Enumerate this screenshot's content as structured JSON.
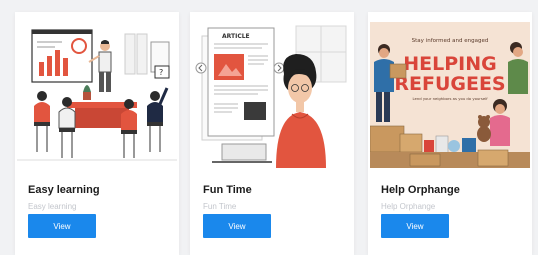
{
  "cards": [
    {
      "title": "Easy learning",
      "subtitle": "Easy learning",
      "button_label": "View",
      "image": "classroom-presentation-illustration"
    },
    {
      "title": "Fun Time",
      "subtitle": "Fun Time",
      "button_label": "View",
      "image": "woman-reading-article-illustration"
    },
    {
      "title": "Help Orphange",
      "subtitle": "Help Orphange",
      "button_label": "View",
      "image": "helping-refugees-poster"
    }
  ],
  "poster": {
    "tagline": "Stay informed and engaged",
    "headline_1": "HELPING",
    "headline_2": "REFUGEES",
    "subline": "Lend your neighbors as you do yourself"
  },
  "article": {
    "heading": "ARTICLE"
  },
  "colors": {
    "accent": "#1a88ec",
    "illustration_red": "#e2553f",
    "poster_red": "#d9453a"
  }
}
